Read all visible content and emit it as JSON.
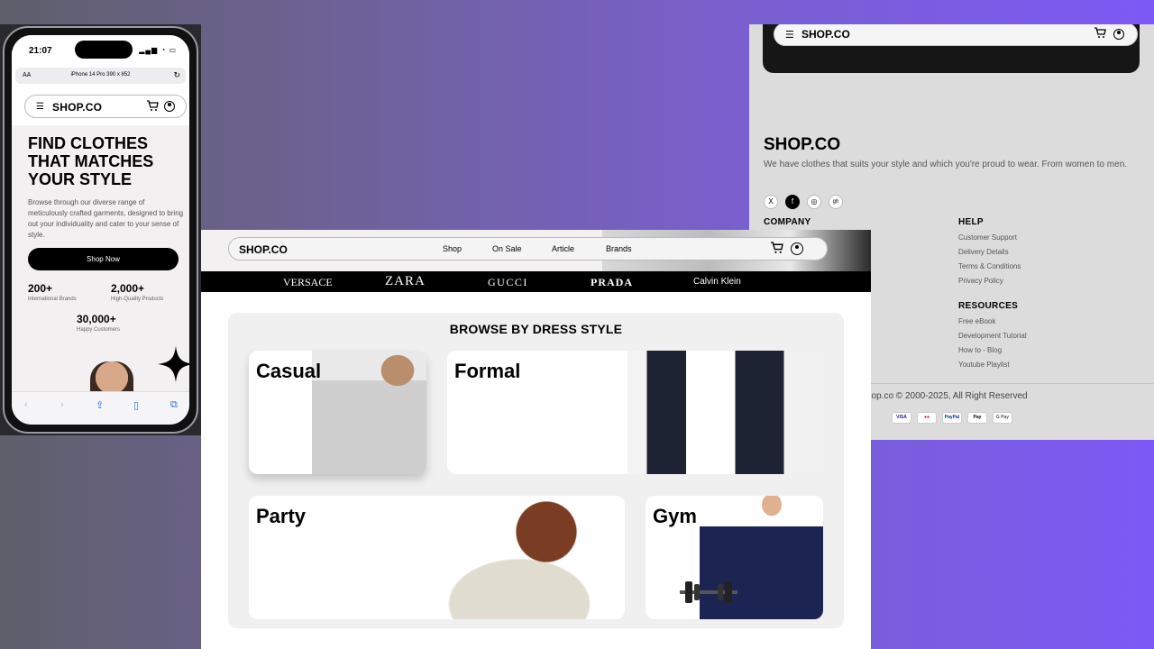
{
  "mobile": {
    "status_time": "21:07",
    "url_aa": "AA",
    "device_label": "iPhone 14 Pro  390 x 852",
    "logo": "SHOP.CO",
    "hero_title": "FIND CLOTHES THAT MATCHES YOUR STYLE",
    "hero_desc": "Browse through our diverse range of meticulously crafted garments, designed to bring out your individuality and cater to your sense of style.",
    "shop_now": "Shop Now",
    "stats": [
      {
        "value": "200+",
        "label": "International Brands"
      },
      {
        "value": "2,000+",
        "label": "High-Quality Products"
      },
      {
        "value": "30,000+",
        "label": "Happy Customers"
      }
    ]
  },
  "footer": {
    "logo": "SHOP.CO",
    "nav_logo": "SHOP.CO",
    "tagline": "We have clothes that suits your style and which you're proud to wear. From women to men.",
    "social": [
      "X",
      "f",
      "◎",
      "gh"
    ],
    "company_heading": "COMPANY",
    "help_heading": "HELP",
    "help_links": [
      "Customer Support",
      "Delivery Details",
      "Terms & Conditions",
      "Privacy Policy"
    ],
    "resources_heading": "RESOURCES",
    "resources_links": [
      "Free eBook",
      "Development Tutorial",
      "How to - Blog",
      "Youtube Playlist"
    ],
    "copyright": "hop.co © 2000-2025, All Right Reserved",
    "payments": [
      "VISA",
      "●●",
      "PayPal",
      "Pay",
      "G Pay"
    ]
  },
  "desktop": {
    "logo": "SHOP.CO",
    "nav_links": [
      "Shop",
      "On Sale",
      "Article",
      "Brands"
    ],
    "brands": [
      "VERSACE",
      "ZARA",
      "GUCCI",
      "PRADA",
      "Calvin Klein"
    ],
    "browse_title": "BROWSE BY DRESS STYLE",
    "styles": [
      "Casual",
      "Formal",
      "Party",
      "Gym"
    ]
  },
  "colors": {
    "background_start": "#5f5f6b",
    "background_end": "#7c59f5",
    "brand_bar": "#000000",
    "browse_panel": "#f0f0f0"
  }
}
